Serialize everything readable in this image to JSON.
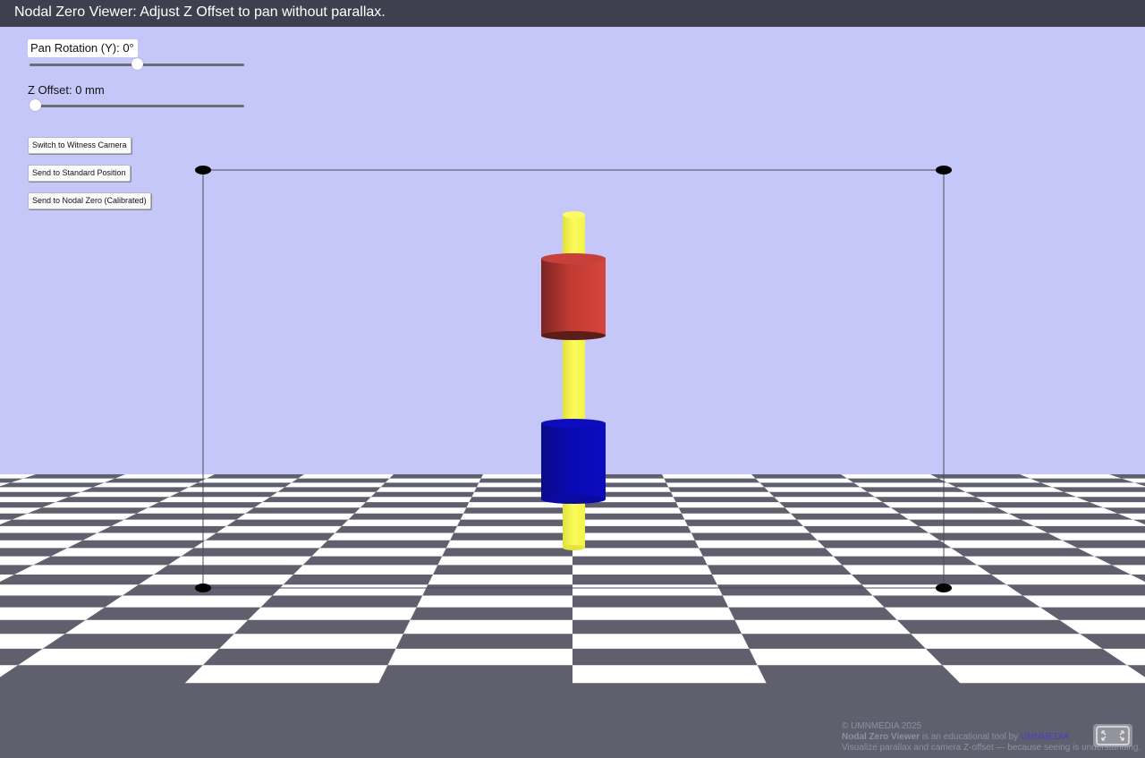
{
  "header": {
    "title": "Nodal Zero Viewer: Adjust Z Offset to pan without parallax."
  },
  "controls": {
    "pan_rotation": {
      "label": "Pan Rotation (Y): 0°",
      "value_deg": 0,
      "position_fraction": 0.5
    },
    "z_offset": {
      "label": "Z Offset: 0 mm",
      "value_mm": 0,
      "position_fraction": 0.0
    },
    "buttons": [
      {
        "label": "Switch to Witness Camera"
      },
      {
        "label": "Send to Standard Position"
      },
      {
        "label": "Send to Nodal Zero (Calibrated)"
      }
    ]
  },
  "scene": {
    "sky_color": "#c5c7f9",
    "checker_dark": "#5f5f6e",
    "checker_light": "#ffffff",
    "pole_color": "#f5f542",
    "upper_cylinder_color": "#c93b35",
    "lower_cylinder_color": "#0c0cb5",
    "frame_marker_color": "#000000"
  },
  "footer": {
    "copyright": "© UMNMEDIA 2025",
    "app_name": "Nodal Zero Viewer",
    "tagline_mid": " is an educational tool by ",
    "brand_link": "UMNMEDIA",
    "tagline2": "Visualize parallax and camera Z-offset — because seeing is understanding."
  },
  "fullscreen": {
    "icon": "fullscreen-icon"
  }
}
